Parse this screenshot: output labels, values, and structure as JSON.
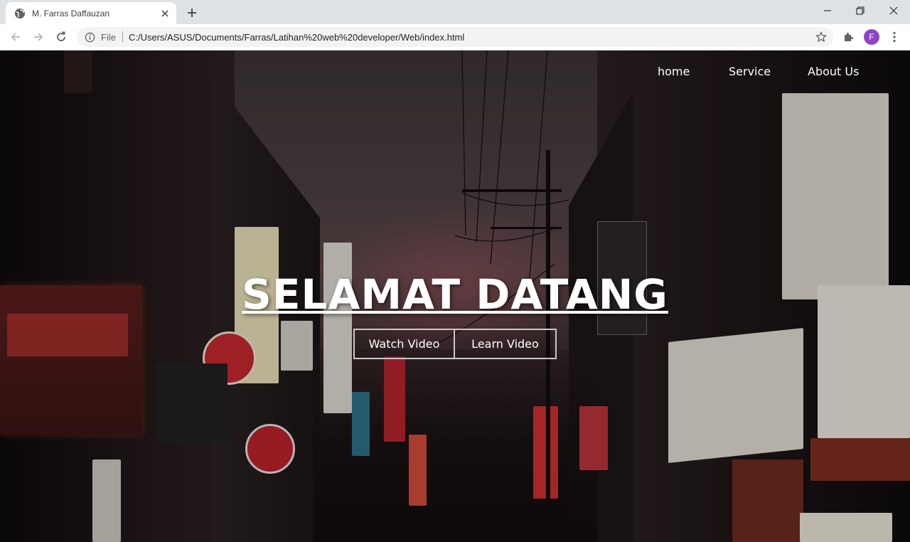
{
  "browser": {
    "tab_title": "M. Farras Daffauzan",
    "file_label": "File",
    "url": "C:/Users/ASUS/Documents/Farras/Latihan%20web%20developer/Web/index.html",
    "profile_initial": "F",
    "profile_color": "#8e44c7"
  },
  "nav": {
    "items": [
      "home",
      "Service",
      "About Us"
    ]
  },
  "hero": {
    "title": "SELAMAT DATANG",
    "buttons": [
      "Watch Video",
      "Learn Video"
    ]
  }
}
